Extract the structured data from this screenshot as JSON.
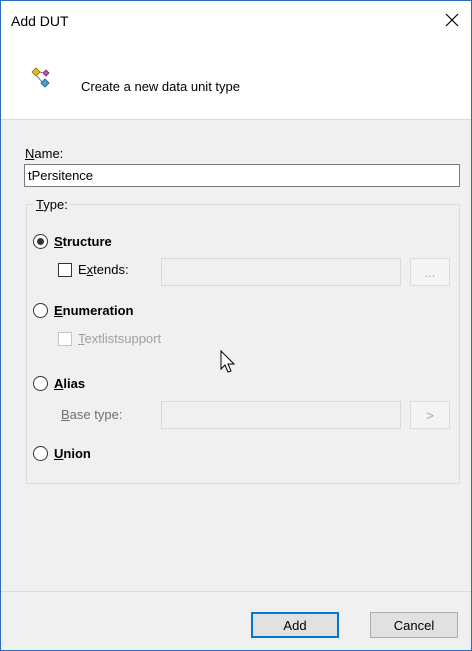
{
  "window": {
    "title": "Add DUT",
    "close_icon": "close-icon"
  },
  "header": {
    "icon": "data-unit-type-icon",
    "description": "Create a new data unit type"
  },
  "form": {
    "name_label": "Name:",
    "name_value": "tPersitence",
    "type_group_label": "Type:",
    "options": {
      "structure": {
        "label": "Structure",
        "selected": true
      },
      "extends": {
        "label": "Extends:",
        "checked": false,
        "browse_label": "..."
      },
      "enumeration": {
        "label": "Enumeration",
        "selected": false
      },
      "textlist_support": {
        "label": "Textlistsupport",
        "checked": false,
        "enabled": false
      },
      "alias": {
        "label": "Alias",
        "selected": false
      },
      "base_type": {
        "label": "Base type:",
        "browse_label": ">"
      },
      "union": {
        "label": "Union",
        "selected": false
      }
    }
  },
  "buttons": {
    "add": "Add",
    "cancel": "Cancel"
  },
  "colors": {
    "accent": "#0078d7",
    "window_border": "#2b6cc4",
    "panel_bg": "#f0f0f0"
  }
}
